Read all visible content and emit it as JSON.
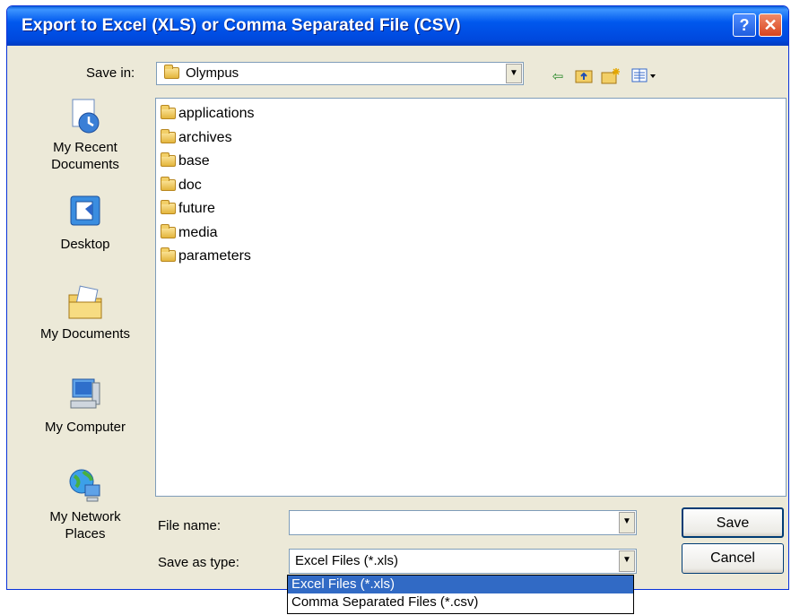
{
  "window": {
    "title": "Export to Excel (XLS) or Comma Separated File (CSV)",
    "help_label": "?",
    "close_label": "X"
  },
  "save_in": {
    "label": "Save in:",
    "value": "Olympus"
  },
  "places": [
    {
      "label": "My Recent Documents",
      "icon": "recent-documents-icon"
    },
    {
      "label": "Desktop",
      "icon": "desktop-icon"
    },
    {
      "label": "My Documents",
      "icon": "my-documents-icon"
    },
    {
      "label": "My Computer",
      "icon": "my-computer-icon"
    },
    {
      "label": "My Network Places",
      "icon": "network-places-icon"
    }
  ],
  "files": [
    "applications",
    "archives",
    "base",
    "doc",
    "future",
    "media",
    "parameters"
  ],
  "file_name": {
    "label": "File name:",
    "value": ""
  },
  "save_as_type": {
    "label": "Save as type:",
    "value": "Excel Files (*.xls)",
    "options": [
      "Excel Files (*.xls)",
      "Comma Separated Files (*.csv)"
    ]
  },
  "buttons": {
    "save": "Save",
    "cancel": "Cancel"
  }
}
